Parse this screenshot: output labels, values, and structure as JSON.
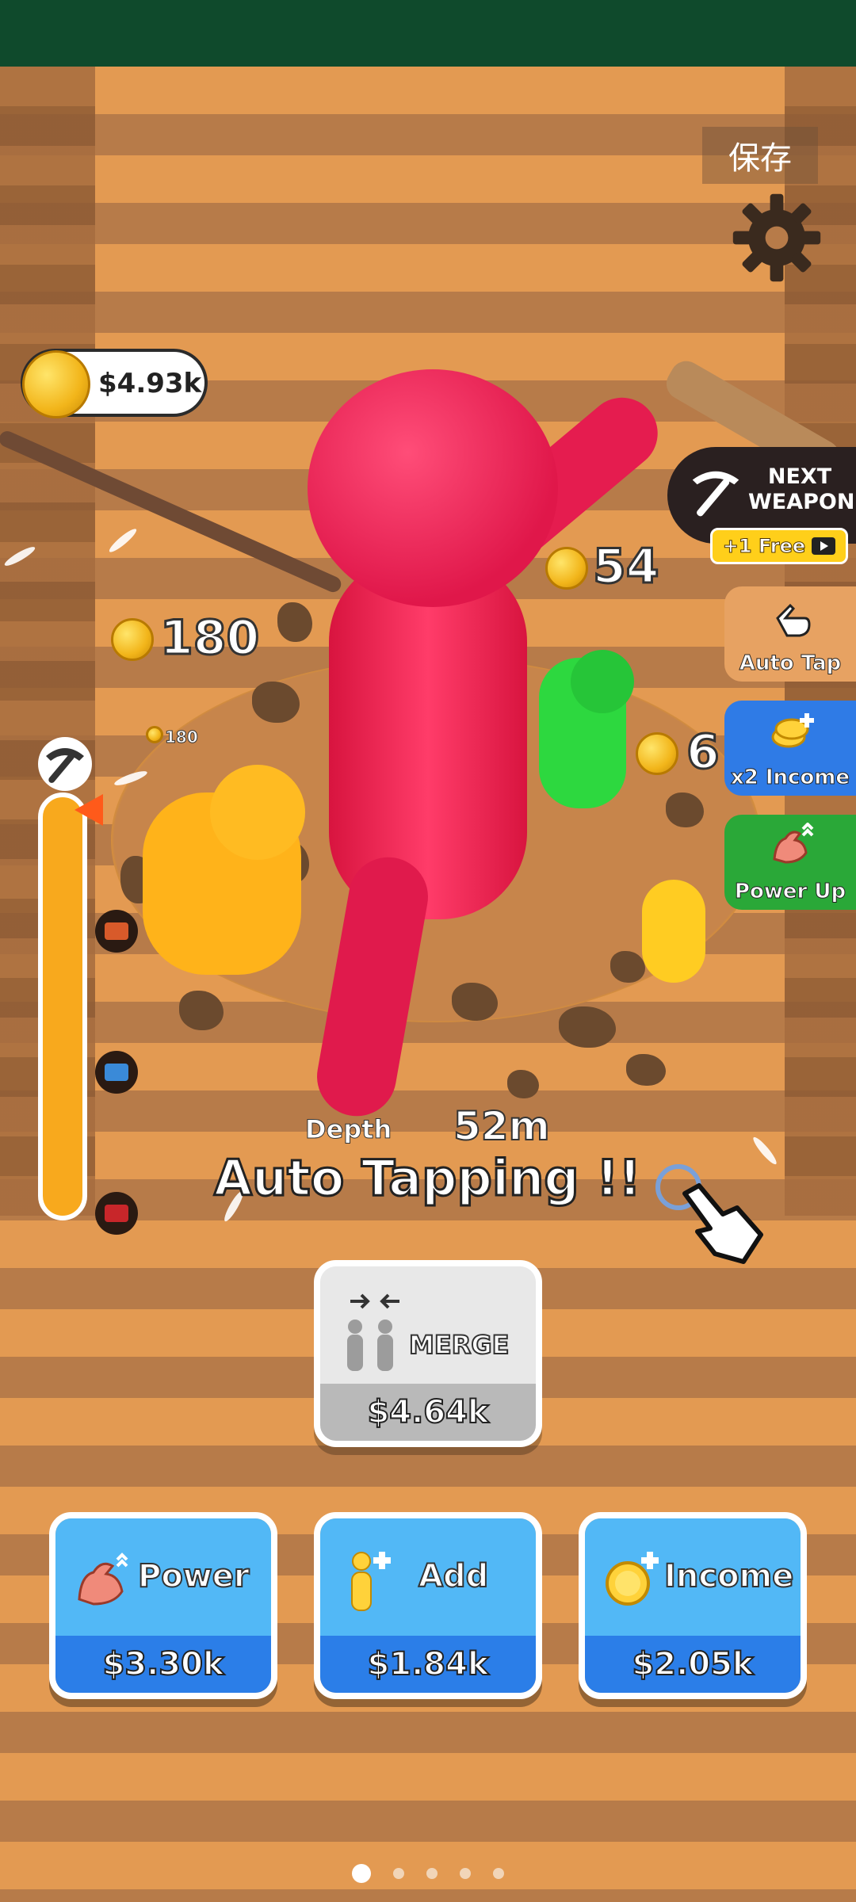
{
  "top_bar": {
    "save_label": "保存"
  },
  "coins": {
    "amount": "$4.93k"
  },
  "floating_rewards": [
    {
      "value": "54"
    },
    {
      "value": "180"
    },
    {
      "value": "180"
    },
    {
      "value": "6"
    }
  ],
  "next_weapon": {
    "label_line1": "NEXT",
    "label_line2": "WEAPON",
    "free_badge": "+1 Free"
  },
  "side_buttons": [
    {
      "label": "Auto Tap",
      "color": "#e7a262",
      "icon": "hand-tap-icon"
    },
    {
      "label": "x2 Income",
      "color": "#2f7be6",
      "icon": "coins-plus-icon"
    },
    {
      "label": "Power Up",
      "color": "#2aa838",
      "icon": "muscle-arm-icon"
    }
  ],
  "depth": {
    "label": "Depth",
    "value": "52m"
  },
  "status": {
    "auto_tapping": "Auto Tapping !!"
  },
  "merge": {
    "label": "MERGE",
    "price": "$4.64k"
  },
  "upgrades": [
    {
      "label": "Power",
      "price": "$3.30k",
      "icon": "muscle-arm-icon"
    },
    {
      "label": "Add",
      "price": "$1.84k",
      "icon": "person-plus-icon"
    },
    {
      "label": "Income",
      "price": "$2.05k",
      "icon": "coin-plus-icon"
    }
  ],
  "pager": {
    "pages": 5,
    "active_index": 0
  },
  "colors": {
    "accent_blue": "#2b7ee8",
    "card_blue": "#52b8f6",
    "red_character": "#e0174a"
  }
}
